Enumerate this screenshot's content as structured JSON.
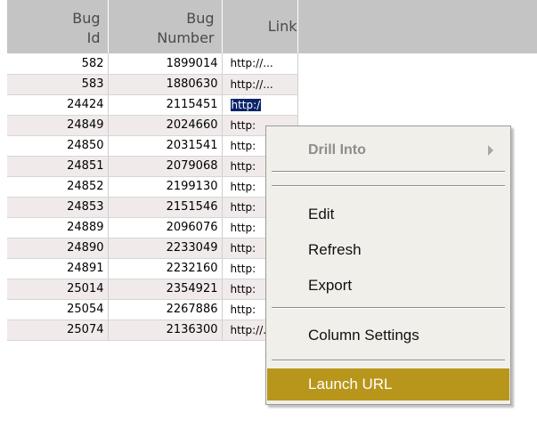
{
  "table": {
    "headers": [
      {
        "line1": "Bug",
        "line2": "Id"
      },
      {
        "line1": "Bug",
        "line2": "Number"
      },
      {
        "line1": "Link",
        "line2": ""
      }
    ],
    "rows": [
      {
        "id": "582",
        "number": "1899014",
        "link": "http://..."
      },
      {
        "id": "583",
        "number": "1880630",
        "link": "http://..."
      },
      {
        "id": "24424",
        "number": "2115451",
        "link": "http://..."
      },
      {
        "id": "24849",
        "number": "2024660",
        "link": "http:"
      },
      {
        "id": "24850",
        "number": "2031541",
        "link": "http:"
      },
      {
        "id": "24851",
        "number": "2079068",
        "link": "http:"
      },
      {
        "id": "24852",
        "number": "2199130",
        "link": "http:"
      },
      {
        "id": "24853",
        "number": "2151546",
        "link": "http:"
      },
      {
        "id": "24889",
        "number": "2096076",
        "link": "http:"
      },
      {
        "id": "24890",
        "number": "2233049",
        "link": "http:"
      },
      {
        "id": "24891",
        "number": "2232160",
        "link": "http:"
      },
      {
        "id": "25014",
        "number": "2354921",
        "link": "http:"
      },
      {
        "id": "25054",
        "number": "2267886",
        "link": "http:"
      },
      {
        "id": "25074",
        "number": "2136300",
        "link": "http://..."
      }
    ],
    "selected_cell": {
      "row": 2,
      "text": "http:/"
    }
  },
  "context_menu": {
    "drill_into": "Drill Into",
    "edit": "Edit",
    "refresh": "Refresh",
    "export": "Export",
    "column_settings": "Column Settings",
    "launch_url": "Launch URL",
    "submenu_arrow_icon": "submenu-arrow-icon",
    "highlight_color": "#b8961c"
  }
}
